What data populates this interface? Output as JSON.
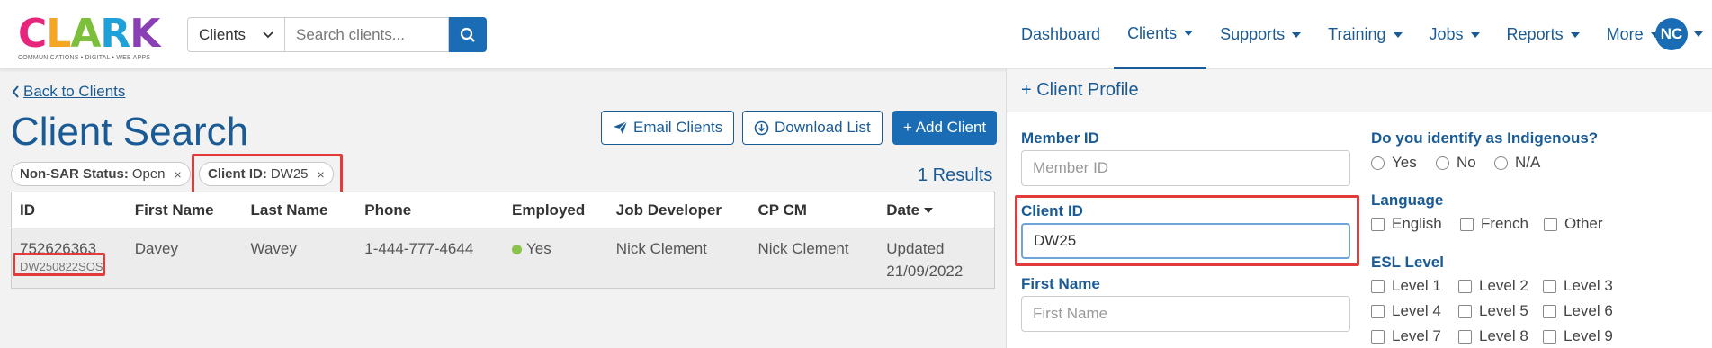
{
  "brand": {
    "logo_letters": [
      "C",
      "L",
      "A",
      "R",
      "K"
    ],
    "logo_colors": [
      "#e6267c",
      "#f5a623",
      "#7cbf3a",
      "#1ea0d8",
      "#8a3fb5"
    ],
    "tagline": "COMMUNICATIONS • DIGITAL • WEB APPS"
  },
  "search": {
    "scope": "Clients",
    "placeholder": "Search clients..."
  },
  "nav": {
    "items": [
      {
        "label": "Dashboard",
        "dropdown": false
      },
      {
        "label": "Clients",
        "dropdown": true,
        "active": true
      },
      {
        "label": "Supports",
        "dropdown": true
      },
      {
        "label": "Training",
        "dropdown": true
      },
      {
        "label": "Jobs",
        "dropdown": true
      },
      {
        "label": "Reports",
        "dropdown": true
      },
      {
        "label": "More",
        "dropdown": true
      }
    ],
    "user_initials": "NC"
  },
  "main": {
    "back_label": "Back to Clients",
    "title": "Client Search",
    "email_btn": "Email Clients",
    "download_btn": "Download List",
    "add_btn": "+ Add Client",
    "filters": [
      {
        "key": "Non-SAR Status:",
        "value": "Open"
      },
      {
        "key": "Client ID:",
        "value": "DW25"
      }
    ],
    "results": "1 Results",
    "columns": [
      "ID",
      "First Name",
      "Last Name",
      "Phone",
      "Employed",
      "Job Developer",
      "CP CM",
      "Date"
    ],
    "rows": [
      {
        "id": "752626363",
        "client_id": "DW250822SOS",
        "first_name": "Davey",
        "last_name": "Wavey",
        "phone": "1-444-777-4644",
        "employed": "Yes",
        "job_developer": "Nick Clement",
        "cp_cm": "Nick Clement",
        "date_line1": "Updated",
        "date_line2": "21/09/2022"
      }
    ]
  },
  "panel": {
    "title": "+ Client Profile",
    "member_id_label": "Member ID",
    "member_id_placeholder": "Member ID",
    "client_id_label": "Client ID",
    "client_id_value": "DW25",
    "first_name_label": "First Name",
    "first_name_placeholder": "First Name",
    "indigenous_label": "Do you identify as Indigenous?",
    "indigenous_options": [
      "Yes",
      "No",
      "N/A"
    ],
    "language_label": "Language",
    "language_options": [
      "English",
      "French",
      "Other"
    ],
    "esl_label": "ESL Level",
    "esl_levels": [
      "Level 1",
      "Level 2",
      "Level 3",
      "Level 4",
      "Level 5",
      "Level 6",
      "Level 7",
      "Level 8",
      "Level 9"
    ]
  },
  "colors": {
    "primary": "#1a6db5",
    "link": "#1a5b96",
    "highlight": "#e23b3b",
    "employed_dot": "#8bc34a"
  }
}
